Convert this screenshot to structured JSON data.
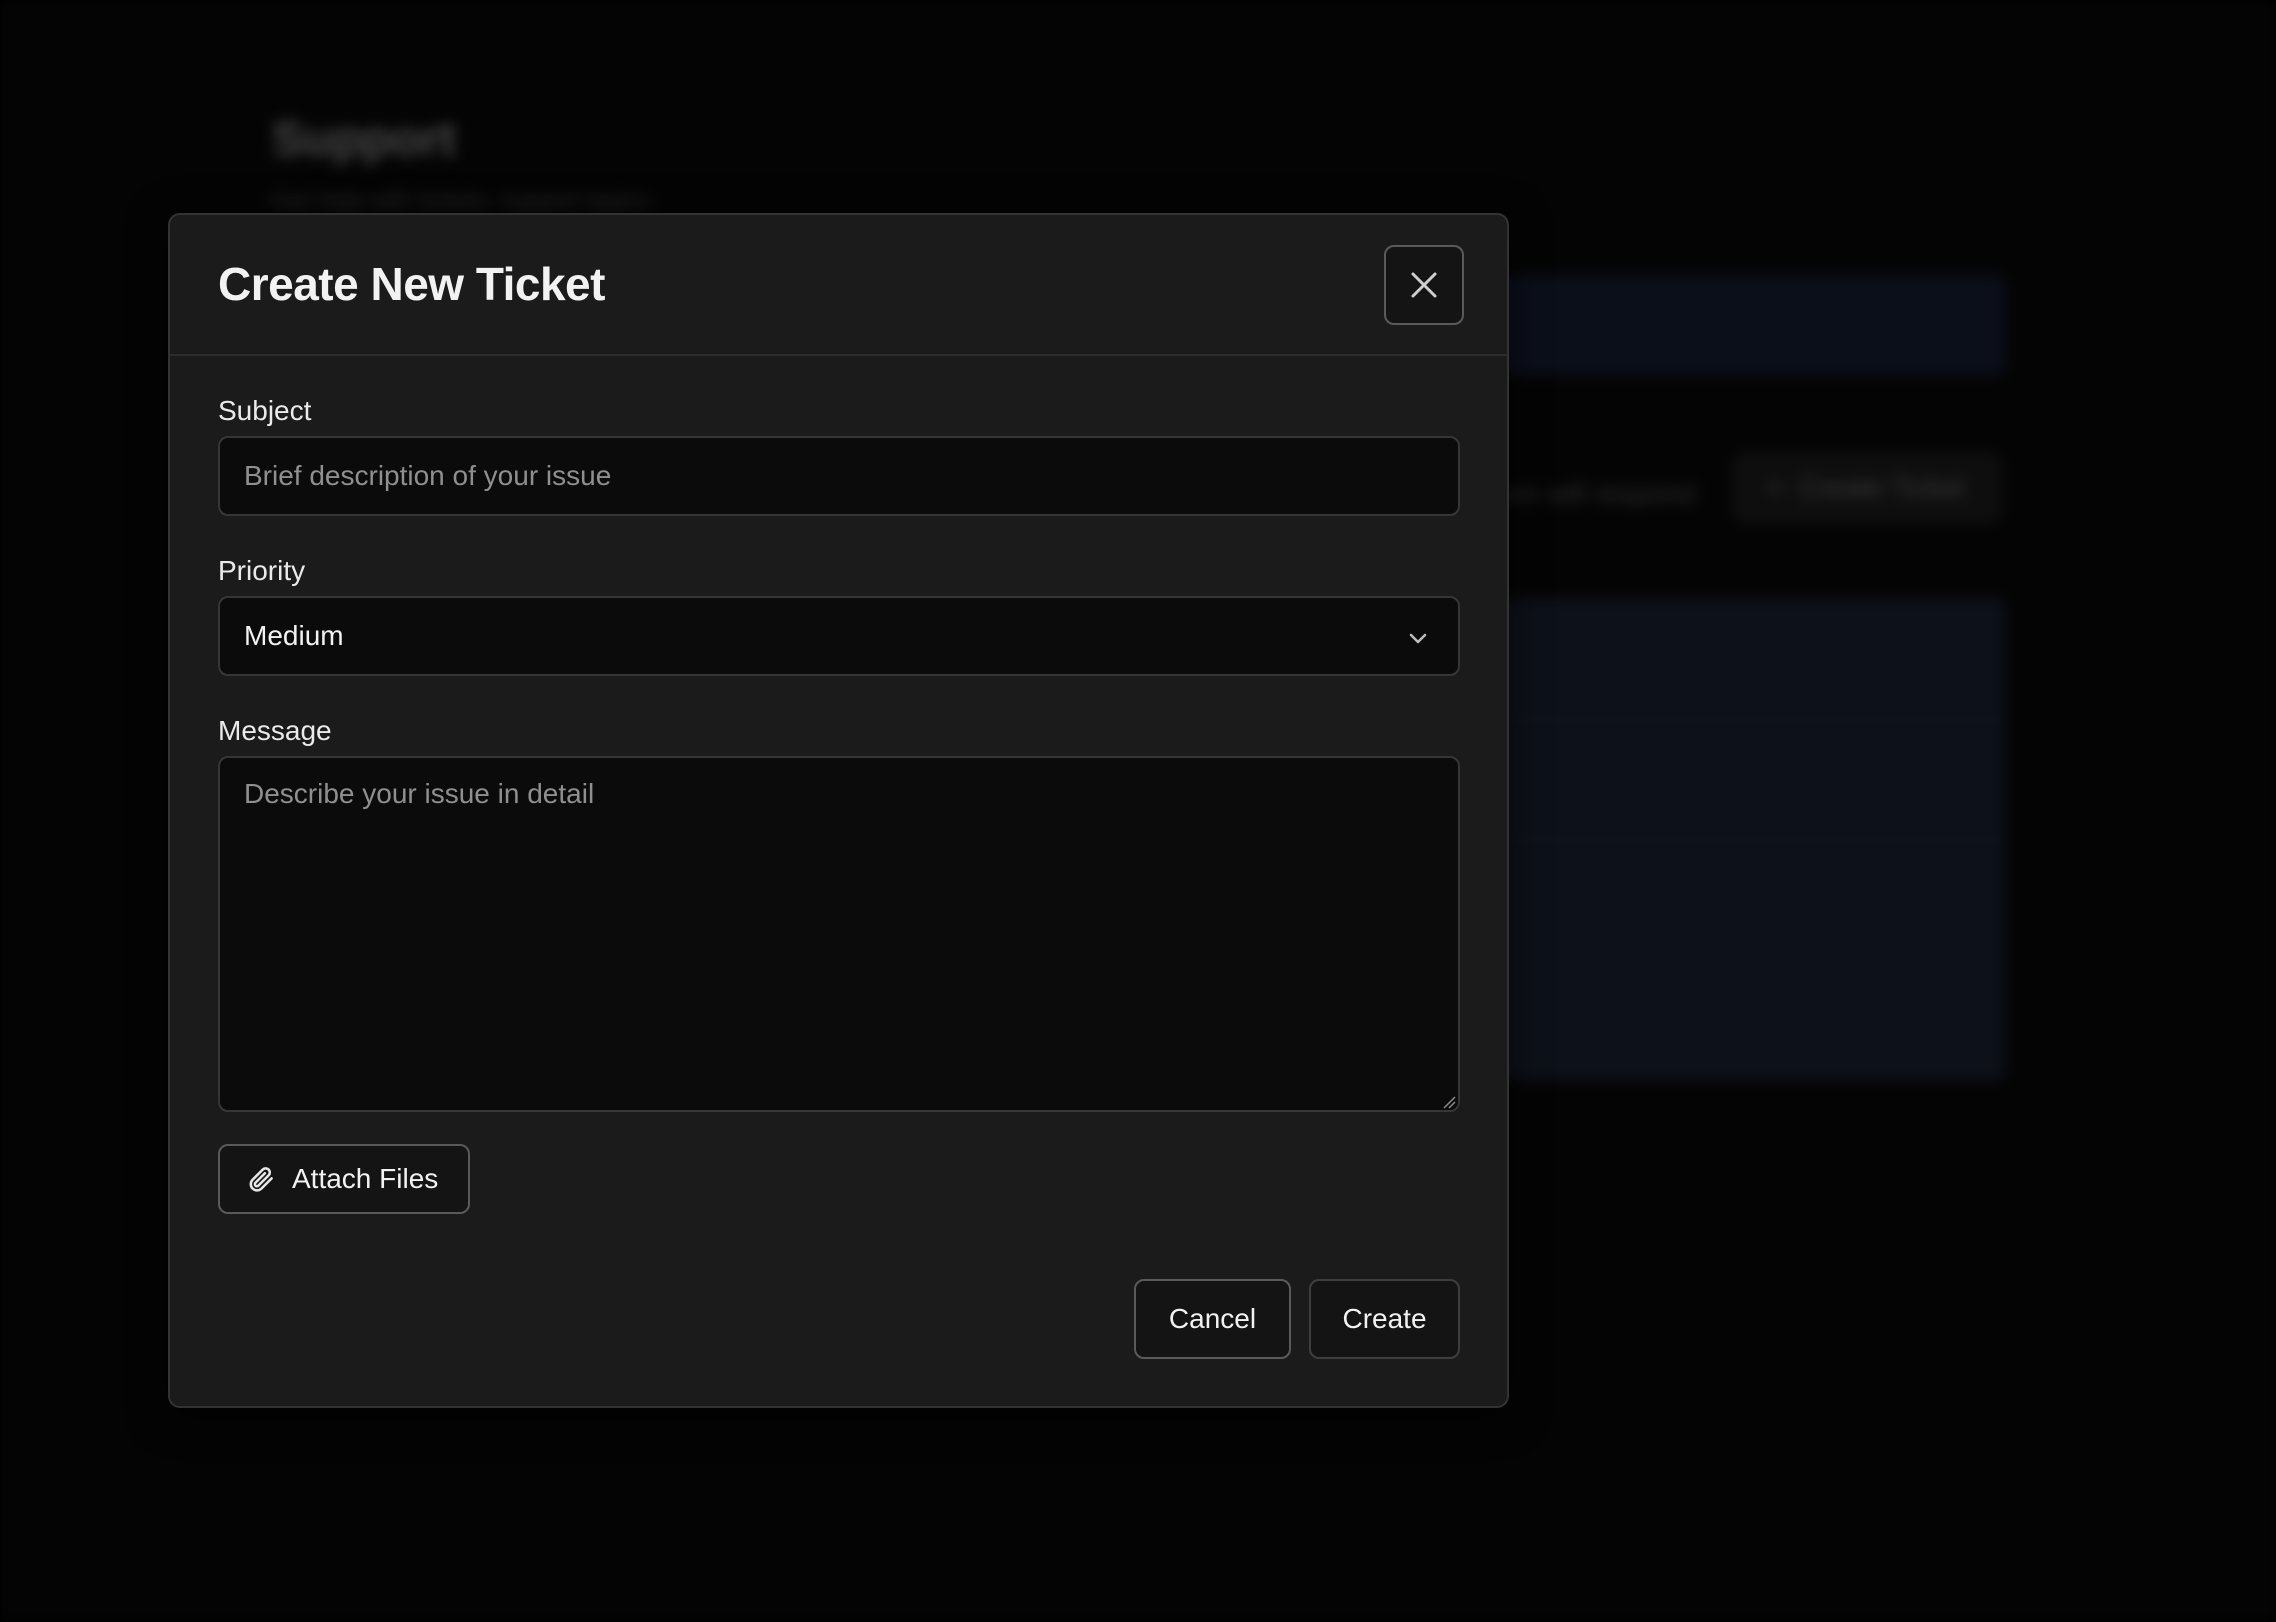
{
  "background_page": {
    "title": "Support",
    "subtitle": "Get help with tickets, support topics",
    "side_text": "ver will respond",
    "create_button_label": "Create Ticket"
  },
  "dialog": {
    "title": "Create New Ticket",
    "close_icon": "close-icon",
    "fields": {
      "subject": {
        "label": "Subject",
        "placeholder": "Brief description of your issue",
        "value": ""
      },
      "priority": {
        "label": "Priority",
        "value": "Medium"
      },
      "message": {
        "label": "Message",
        "placeholder": "Describe your issue in detail",
        "value": ""
      }
    },
    "attach_button": {
      "label": "Attach Files",
      "icon": "paperclip-icon"
    },
    "actions": {
      "cancel_label": "Cancel",
      "create_label": "Create"
    }
  },
  "colors": {
    "page_background": "#000000",
    "dialog_background": "#1b1b1b",
    "input_background": "#0b0b0b",
    "text_primary": "#f2f2f2",
    "placeholder": "#8f8f8f"
  }
}
